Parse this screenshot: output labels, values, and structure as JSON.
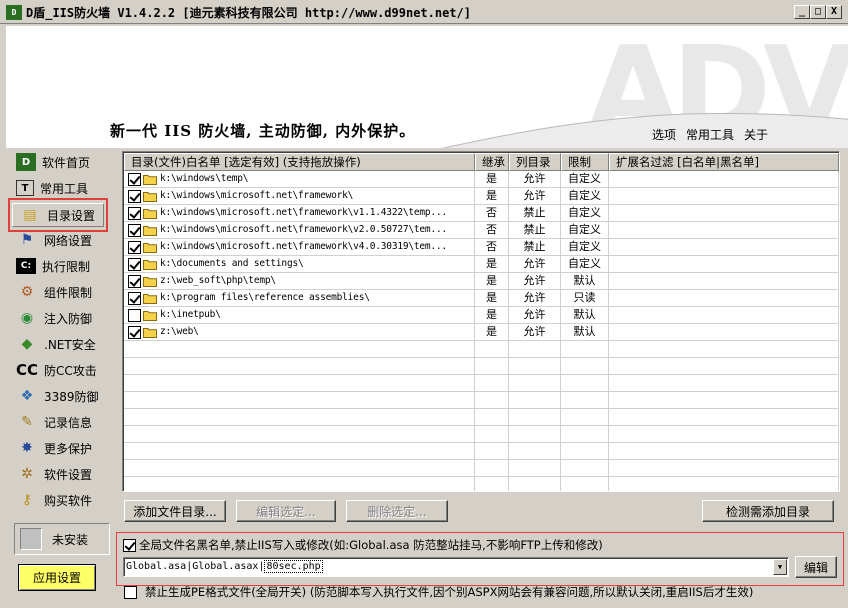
{
  "window": {
    "title": "D盾_IIS防火墙 V1.4.2.2 [迪元素科技有限公司 http://www.d99net.net/]",
    "icon_text": "D",
    "minimize": "_",
    "maximize": "□",
    "close": "X"
  },
  "banner": {
    "logo_text": "ADV",
    "slogan": "新一代 IIS 防火墙, 主动防御, 内外保护。",
    "menu": [
      "选项",
      "常用工具",
      "关于"
    ]
  },
  "sidebar": {
    "items": [
      {
        "label": "软件首页",
        "icon": "d99-logo-icon",
        "glyph": "D"
      },
      {
        "label": "常用工具",
        "icon": "tools-icon",
        "glyph": "T"
      },
      {
        "label": "目录设置",
        "icon": "folder-settings-icon",
        "glyph": "▤"
      },
      {
        "label": "网络设置",
        "icon": "network-icon",
        "glyph": "⚑"
      },
      {
        "label": "执行限制",
        "icon": "console-icon",
        "glyph": "C:"
      },
      {
        "label": "组件限制",
        "icon": "component-icon",
        "glyph": "⚙"
      },
      {
        "label": "注入防御",
        "icon": "globe-icon",
        "glyph": "◉"
      },
      {
        "label": ".NET安全",
        "icon": "dotnet-icon",
        "glyph": "◆"
      },
      {
        "label": "防CC攻击",
        "icon": "cc-icon",
        "glyph": "CC"
      },
      {
        "label": "3389防御",
        "icon": "remote-desktop-icon",
        "glyph": "❖"
      },
      {
        "label": "记录信息",
        "icon": "log-icon",
        "glyph": "✎"
      },
      {
        "label": "更多保护",
        "icon": "satellite-icon",
        "glyph": "✸"
      },
      {
        "label": "软件设置",
        "icon": "gear-icon",
        "glyph": "✲"
      },
      {
        "label": "购买软件",
        "icon": "key-icon",
        "glyph": "⚷"
      }
    ],
    "status_label": "未安装",
    "apply_label": "应用设置"
  },
  "table": {
    "columns": [
      "目录(文件)白名单 [选定有效] (支持拖放操作)",
      "继承",
      "列目录",
      "限制",
      "扩展名过滤 [白名单|黑名单]"
    ],
    "rows": [
      {
        "checked": true,
        "path": "k:\\windows\\temp\\",
        "inherit": "是",
        "list": "允许",
        "limit": "自定义",
        "ext": ""
      },
      {
        "checked": true,
        "path": "k:\\windows\\microsoft.net\\framework\\",
        "inherit": "是",
        "list": "允许",
        "limit": "自定义",
        "ext": ""
      },
      {
        "checked": true,
        "path": "k:\\windows\\microsoft.net\\framework\\v1.1.4322\\temp...",
        "inherit": "否",
        "list": "禁止",
        "limit": "自定义",
        "ext": ""
      },
      {
        "checked": true,
        "path": "k:\\windows\\microsoft.net\\framework\\v2.0.50727\\tem...",
        "inherit": "否",
        "list": "禁止",
        "limit": "自定义",
        "ext": ""
      },
      {
        "checked": true,
        "path": "k:\\windows\\microsoft.net\\framework\\v4.0.30319\\tem...",
        "inherit": "否",
        "list": "禁止",
        "limit": "自定义",
        "ext": ""
      },
      {
        "checked": true,
        "path": "k:\\documents and settings\\",
        "inherit": "是",
        "list": "允许",
        "limit": "自定义",
        "ext": ""
      },
      {
        "checked": true,
        "path": "z:\\web_soft\\php\\temp\\",
        "inherit": "是",
        "list": "允许",
        "limit": "默认",
        "ext": ""
      },
      {
        "checked": true,
        "path": "k:\\program files\\reference assemblies\\",
        "inherit": "是",
        "list": "允许",
        "limit": "只读",
        "ext": ""
      },
      {
        "checked": false,
        "path": "k:\\inetpub\\",
        "inherit": "是",
        "list": "允许",
        "limit": "默认",
        "ext": ""
      },
      {
        "checked": true,
        "path": "z:\\web\\",
        "inherit": "是",
        "list": "允许",
        "limit": "默认",
        "ext": ""
      }
    ]
  },
  "buttons": {
    "add": "添加文件目录...",
    "edit": "编辑选定...",
    "delete": "删除选定...",
    "detect": "检测需添加目录"
  },
  "blacklist": {
    "checked": true,
    "label": "全局文件名黑名单,禁止IIS写入或修改(如:Global.asa 防范整站挂马,不影响FTP上传和修改)",
    "value_prefix": "Global.asa|Global.asax|",
    "value_selected": "80sec.php",
    "edit_button": "编辑"
  },
  "pe_option": {
    "checked": false,
    "label": "禁止生成PE格式文件(全局开关) (防范脚本写入执行文件,因个别ASPX网站会有兼容问题,所以默认关闭,重启IIS后才生效)"
  },
  "colors": {
    "window_bg": "#d4d0c8",
    "highlight_border": "#e0403a",
    "apply_button": "#ffff66",
    "folder": "#f4d24a"
  }
}
